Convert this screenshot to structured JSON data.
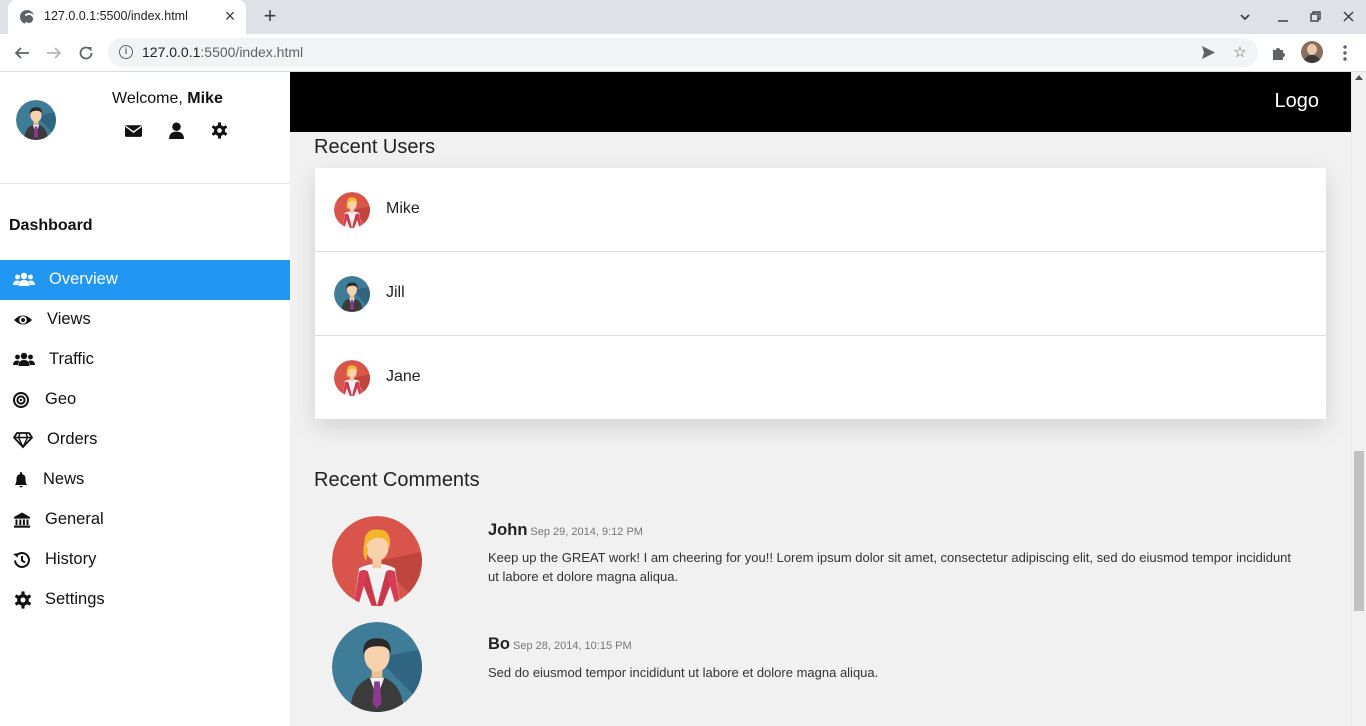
{
  "browser": {
    "tab_title": "127.0.0.1:5500/index.html",
    "url_host": "127.0.0.1",
    "url_rest": ":5500/index.html"
  },
  "sidebar": {
    "welcome_prefix": "Welcome, ",
    "user_name": "Mike",
    "heading": "Dashboard",
    "items": [
      {
        "label": "Overview",
        "icon": "users-icon",
        "active": true
      },
      {
        "label": "Views",
        "icon": "eye-icon"
      },
      {
        "label": "Traffic",
        "icon": "users-icon"
      },
      {
        "label": "Geo",
        "icon": "bullseye-icon"
      },
      {
        "label": "Orders",
        "icon": "diamond-icon"
      },
      {
        "label": "News",
        "icon": "bell-icon"
      },
      {
        "label": "General",
        "icon": "bank-icon"
      },
      {
        "label": "History",
        "icon": "history-icon"
      },
      {
        "label": "Settings",
        "icon": "gear-icon"
      }
    ]
  },
  "header": {
    "logo": "Logo"
  },
  "recent_users": {
    "title": "Recent Users",
    "users": [
      {
        "name": "Mike",
        "avatar": "female-avatar"
      },
      {
        "name": "Jill",
        "avatar": "male-avatar"
      },
      {
        "name": "Jane",
        "avatar": "female-avatar"
      }
    ]
  },
  "recent_comments": {
    "title": "Recent Comments",
    "comments": [
      {
        "author": "John",
        "date": "Sep 29, 2014, 9:12 PM",
        "text": "Keep up the GREAT work! I am cheering for you!! Lorem ipsum dolor sit amet, consectetur adipiscing elit, sed do eiusmod tempor incididunt ut labore et dolore magna aliqua.",
        "avatar": "female-avatar"
      },
      {
        "author": "Bo",
        "date": "Sep 28, 2014, 10:15 PM",
        "text": "Sed do eiusmod tempor incididunt ut labore et dolore magna aliqua.",
        "avatar": "male-avatar"
      }
    ]
  },
  "colors": {
    "active": "#2196f3",
    "topbar": "#000000",
    "content_bg": "#f1f1f1"
  }
}
